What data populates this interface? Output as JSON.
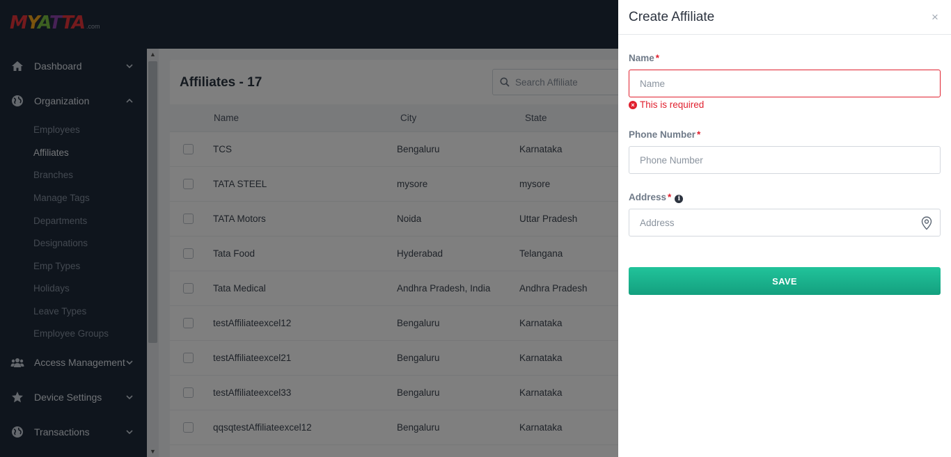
{
  "brand": {
    "logo_text": "MYATTA",
    "logo_suffix": ".com"
  },
  "sidebar": {
    "items": [
      {
        "label": "Dashboard",
        "icon": "home-icon"
      },
      {
        "label": "Organization",
        "icon": "globe-icon",
        "expanded": true
      },
      {
        "label": "Access Management",
        "icon": "users-icon"
      },
      {
        "label": "Device Settings",
        "icon": "star-icon"
      },
      {
        "label": "Transactions",
        "icon": "globe-icon"
      }
    ],
    "organization_sub": [
      "Employees",
      "Affiliates",
      "Branches",
      "Manage Tags",
      "Departments",
      "Designations",
      "Emp Types",
      "Holidays",
      "Leave Types",
      "Employee Groups"
    ],
    "active_sub": "Affiliates"
  },
  "main": {
    "title": "Affiliates - 17",
    "search_placeholder": "Search Affiliate",
    "columns": [
      "Name",
      "City",
      "State"
    ],
    "rows": [
      [
        "TCS",
        "Bengaluru",
        "Karnataka"
      ],
      [
        "TATA STEEL",
        "mysore",
        "mysore"
      ],
      [
        "TATA Motors",
        "Noida",
        "Uttar Pradesh"
      ],
      [
        "Tata Food",
        "Hyderabad",
        "Telangana"
      ],
      [
        "Tata Medical",
        "Andhra Pradesh, India",
        "Andhra Pradesh"
      ],
      [
        "testAffiliateexcel12",
        "Bengaluru",
        "Karnataka"
      ],
      [
        "testAffiliateexcel21",
        "Bengaluru",
        "Karnataka"
      ],
      [
        "testAffiliateexcel33",
        "Bengaluru",
        "Karnataka"
      ],
      [
        "qqsqtestAffiliateexcel12",
        "Bengaluru",
        "Karnataka"
      ]
    ]
  },
  "drawer": {
    "title": "Create Affiliate",
    "close": "×",
    "name_label": "Name",
    "name_placeholder": "Name",
    "name_error": "This is required",
    "phone_label": "Phone Number",
    "phone_placeholder": "Phone Number",
    "address_label": "Address",
    "address_placeholder": "Address",
    "required_mark": "*",
    "save_label": "SAVE"
  },
  "colors": {
    "sidebar_bg": "#1f2a3a",
    "accent": "#1ab38d",
    "error": "#e0202e"
  }
}
